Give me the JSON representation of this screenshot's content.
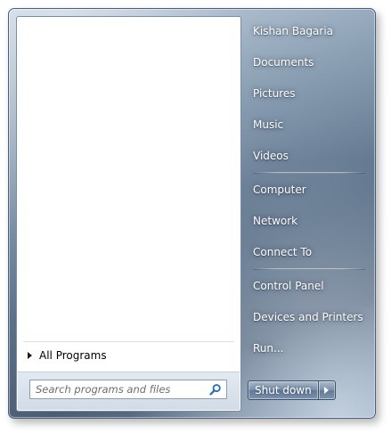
{
  "left_pane": {
    "all_programs_label": "All Programs",
    "search": {
      "placeholder": "Search programs and files",
      "value": ""
    }
  },
  "right_pane": {
    "groups": [
      [
        {
          "label": "Kishan Bagaria"
        },
        {
          "label": "Documents"
        },
        {
          "label": "Pictures"
        },
        {
          "label": "Music"
        },
        {
          "label": "Videos"
        }
      ],
      [
        {
          "label": "Computer"
        },
        {
          "label": "Network"
        },
        {
          "label": "Connect To"
        }
      ],
      [
        {
          "label": "Control Panel"
        },
        {
          "label": "Devices and Printers"
        },
        {
          "label": "Run..."
        }
      ]
    ]
  },
  "shutdown": {
    "label": "Shut down"
  },
  "icons": {
    "search": "search-icon",
    "all_programs_arrow": "triangle-right-icon",
    "shutdown_options": "triangle-right-icon"
  },
  "colors": {
    "frame": "#4b5e74",
    "text_right": "#ffffff",
    "search_icon": "#1f6fc5"
  }
}
